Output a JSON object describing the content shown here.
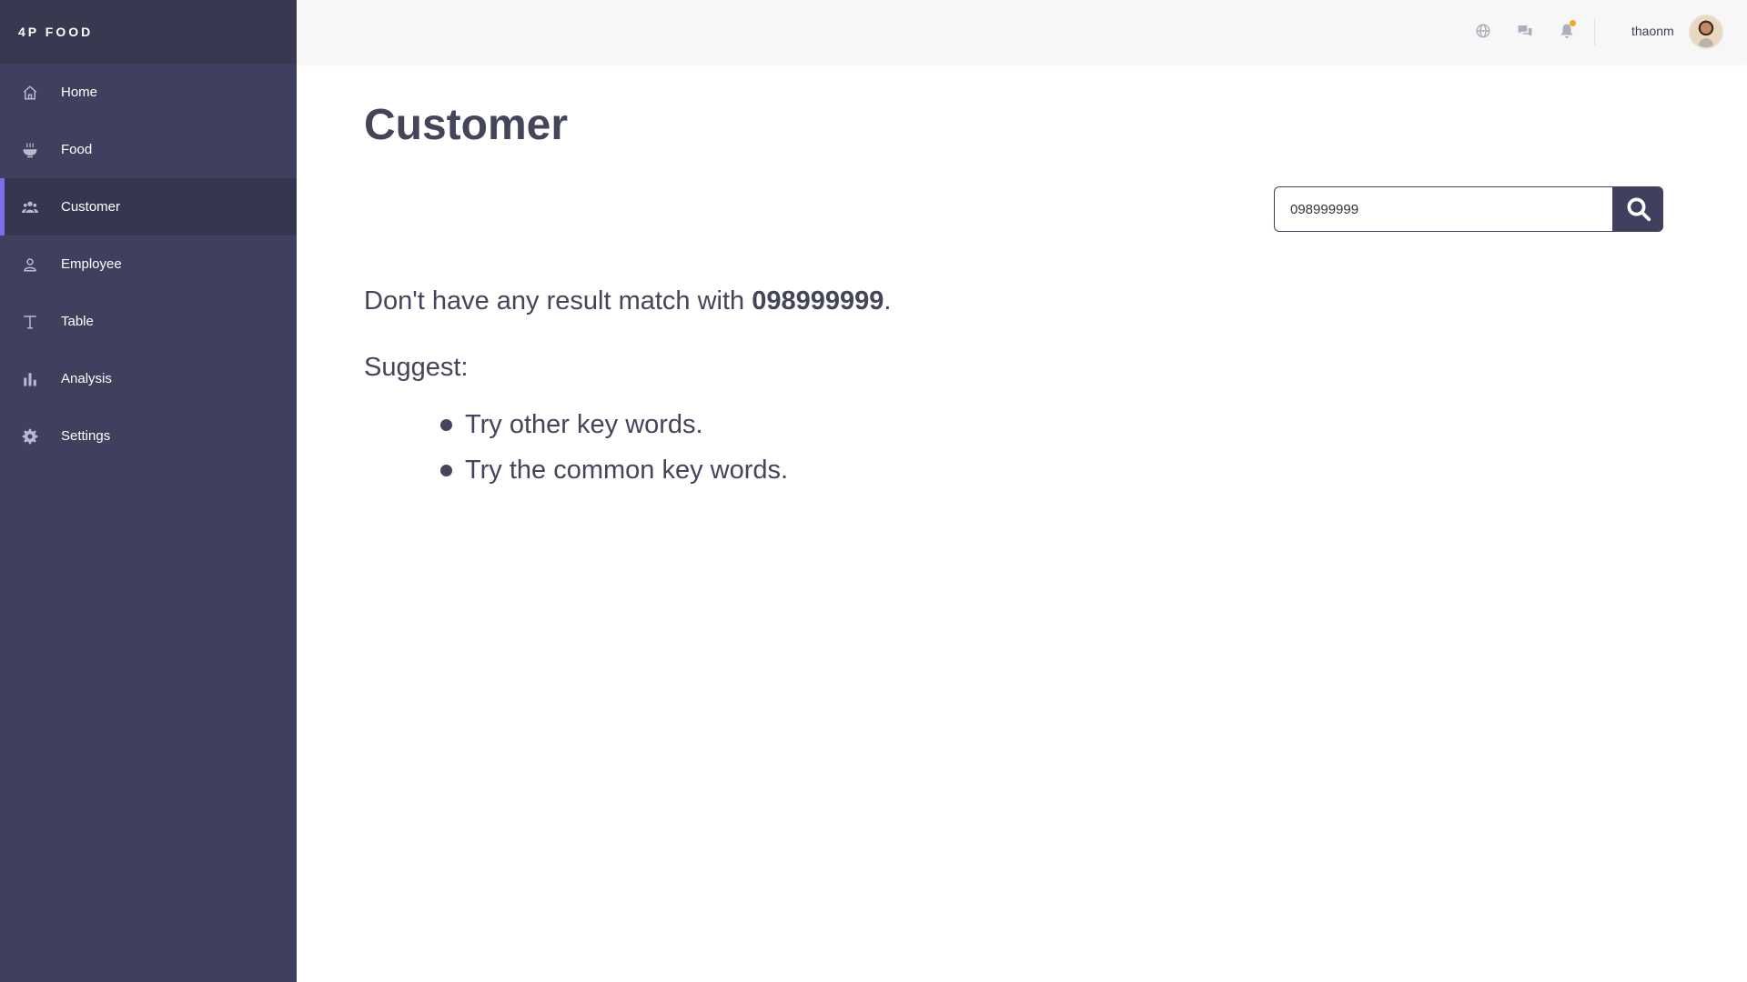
{
  "sidebar": {
    "brand": "4P FOOD",
    "items": [
      {
        "label": "Home",
        "icon": "home-icon"
      },
      {
        "label": "Food",
        "icon": "bowl-icon"
      },
      {
        "label": "Customer",
        "icon": "users-icon",
        "active": true
      },
      {
        "label": "Employee",
        "icon": "user-icon"
      },
      {
        "label": "Table",
        "icon": "table-icon"
      },
      {
        "label": "Analysis",
        "icon": "bar-chart-icon"
      },
      {
        "label": "Settings",
        "icon": "gear-icon"
      }
    ]
  },
  "topbar": {
    "icons": [
      "globe-icon",
      "chat-icon",
      "bell-icon"
    ],
    "username": "thaonm"
  },
  "main": {
    "title": "Customer",
    "search": {
      "value": "098999999",
      "button_icon": "search-icon"
    },
    "no_result": {
      "prefix": "Don't have any result match with ",
      "keyword": "098999999",
      "suffix": "."
    },
    "suggest_title": "Suggest:",
    "suggestions": [
      "Try other key words.",
      "Try the common key words."
    ]
  },
  "colors": {
    "sidebar_bg": "#3f405d",
    "sidebar_brand_bg": "#383950",
    "active_bg": "#353650",
    "active_accent": "#7d6cf0",
    "topbar_bg": "#f7f7f7",
    "notification_dot": "#f5a623",
    "text": "#44445a"
  }
}
